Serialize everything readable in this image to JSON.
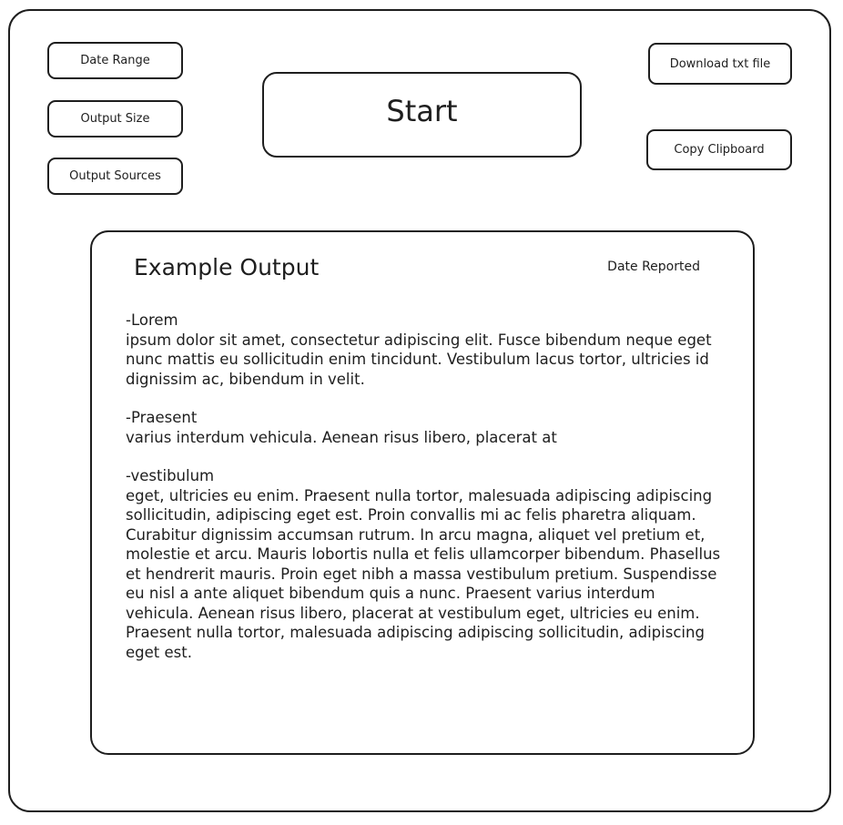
{
  "controls": {
    "date_range_label": "Date Range",
    "output_size_label": "Output Size",
    "output_sources_label": "Output Sources",
    "start_label": "Start",
    "download_label": "Download txt file",
    "copy_label": "Copy Clipboard"
  },
  "output": {
    "title": "Example Output",
    "date_label": "Date Reported",
    "entries": [
      {
        "heading": "-Lorem",
        "body": "ipsum dolor sit amet, consectetur adipiscing elit. Fusce bibendum neque eget nunc mattis eu sollicitudin enim tincidunt. Vestibulum lacus tortor, ultricies id dignissim ac, bibendum in velit."
      },
      {
        "heading": "-Praesent",
        "body": "varius interdum vehicula. Aenean risus libero, placerat at"
      },
      {
        "heading": "-vestibulum",
        "body": "eget, ultricies eu enim. Praesent nulla tortor, malesuada adipiscing adipiscing sollicitudin, adipiscing eget est. Proin convallis mi ac felis pharetra aliquam. Curabitur dignissim accumsan rutrum. In arcu magna, aliquet vel pretium et, molestie et arcu. Mauris lobortis nulla et felis ullamcorper bibendum. Phasellus et hendrerit mauris. Proin eget nibh a massa vestibulum pretium. Suspendisse eu nisl a ante aliquet bibendum quis a nunc. Praesent varius interdum vehicula. Aenean risus libero, placerat at vestibulum eget, ultricies eu enim. Praesent nulla tortor, malesuada adipiscing adipiscing sollicitudin, adipiscing eget est."
      }
    ]
  }
}
